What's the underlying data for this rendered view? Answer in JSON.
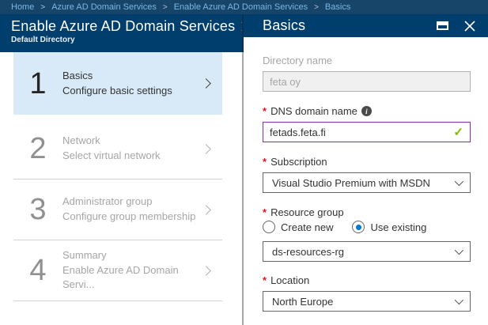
{
  "ui": {
    "required_marker": "*",
    "check_glyph": "✓",
    "separator": ">",
    "info_glyph": "i"
  },
  "colors": {
    "breadcrumb_bg": "#164569",
    "header_bg": "#003e6d",
    "selected_step_bg": "#d8eaf8",
    "link_blue": "#7ab7e2",
    "valid_green": "#7fba00",
    "dns_border_purple": "#8a2da5",
    "radio_blue": "#0078d4",
    "required_red": "#e81123"
  },
  "breadcrumb": {
    "items": [
      "Home",
      "Azure AD Domain Services",
      "Enable Azure AD Domain Services",
      "Basics"
    ]
  },
  "left_panel": {
    "title": "Enable Azure AD Domain Services",
    "subtitle": "Default Directory",
    "steps": [
      {
        "number": "1",
        "title": "Basics",
        "subtitle": "Configure basic settings",
        "state": "selected"
      },
      {
        "number": "2",
        "title": "Network",
        "subtitle": "Select virtual network",
        "state": "disabled"
      },
      {
        "number": "3",
        "title": "Administrator group",
        "subtitle": "Configure group membership",
        "state": "disabled"
      },
      {
        "number": "4",
        "title": "Summary",
        "subtitle": "Enable Azure AD Domain Servi...",
        "state": "disabled"
      }
    ]
  },
  "right_panel": {
    "title": "Basics",
    "fields": {
      "directory_name": {
        "label": "Directory name",
        "value": "feta oy",
        "disabled": true
      },
      "dns_domain_name": {
        "label": "DNS domain name",
        "value": "fetads.feta.fi",
        "required": true,
        "valid": true
      },
      "subscription": {
        "label": "Subscription",
        "value": "Visual Studio Premium with MSDN",
        "required": true
      },
      "resource_group": {
        "label": "Resource group",
        "required": true,
        "options": [
          "Create new",
          "Use existing"
        ],
        "selected_option": "Use existing",
        "value": "ds-resources-rg"
      },
      "location": {
        "label": "Location",
        "value": "North Europe",
        "required": true
      }
    }
  }
}
